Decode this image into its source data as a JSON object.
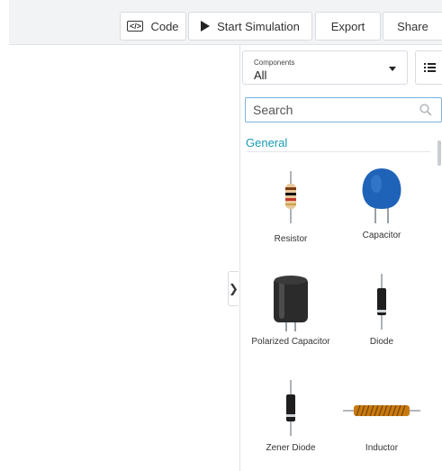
{
  "toolbar": {
    "code_label": "Code",
    "code_icon_text": "</>",
    "start_simulation_label": "Start Simulation",
    "export_label": "Export",
    "share_label": "Share"
  },
  "panel": {
    "components_label": "Components",
    "components_value": "All",
    "search_placeholder": "Search",
    "section_title": "General",
    "items": [
      {
        "label": "Resistor",
        "icon": "resistor-icon"
      },
      {
        "label": "Capacitor",
        "icon": "capacitor-icon"
      },
      {
        "label": "Polarized Capacitor",
        "icon": "polarized-capacitor-icon"
      },
      {
        "label": "Diode",
        "icon": "diode-icon"
      },
      {
        "label": "Zener Diode",
        "icon": "zener-diode-icon"
      },
      {
        "label": "Inductor",
        "icon": "inductor-icon"
      }
    ]
  },
  "colors": {
    "accent": "#1a9bb5",
    "capacitor_blue": "#1f63b8",
    "inductor_copper": "#c87a10"
  }
}
